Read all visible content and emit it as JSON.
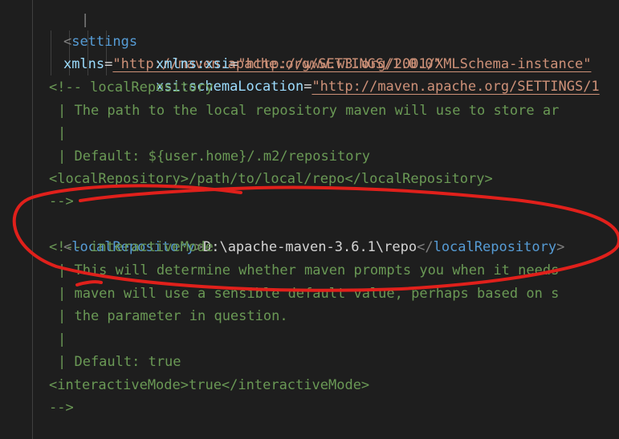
{
  "editor": {
    "settings": {
      "tag": "settings",
      "attr1_name": "xmlns",
      "attr1_value": "\"http://maven.apache.org/SETTINGS/1.0.0\"",
      "attr2_name": "xmlns:xsi",
      "attr2_value": "\"http://www.w3.org/2001/XMLSchema-instance\"",
      "attr3_name": "xsi:schemaLocation",
      "attr3_value": "\"http://maven.apache.org/SETTINGS/1"
    },
    "comment1": {
      "open": "<!-- localRepository",
      "line1": "| The path to the local repository maven will use to store ar",
      "line2": "|",
      "line3": "| Default: ${user.home}/.m2/repository",
      "line4": "<localRepository>/path/to/local/repo</localRepository>",
      "close": "-->"
    },
    "local_repo": {
      "tag": "localRepository",
      "value": "D:\\apache-maven-3.6.1\\repo"
    },
    "comment2": {
      "open": "<!-- interactiveMode",
      "line1": "| This will determine whether maven prompts you when it needs",
      "line2": "| maven will use a sensible default value, perhaps based on s",
      "line3": "| the parameter in question.",
      "line4": "|",
      "line5": "| Default: true",
      "line6": "<interactiveMode>true</interactiveMode>",
      "close": "-->"
    },
    "top_guide_char": "|"
  },
  "annotation": {
    "color": "#e0201b",
    "shape": "hand-drawn-ellipse"
  }
}
